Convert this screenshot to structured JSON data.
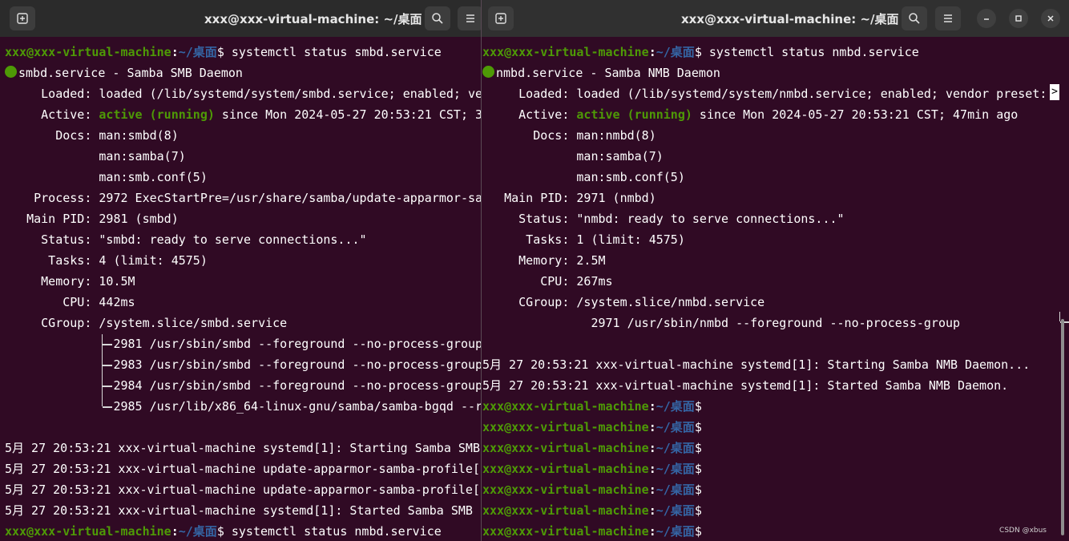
{
  "colors": {
    "terminal_bg": "#300a24",
    "titlebar_bg": "#2b2b2b",
    "prompt_user": "#4e9a06",
    "prompt_path": "#3465a4",
    "active": "#4e9a06"
  },
  "left_window": {
    "title": "xxx@xxx-virtual-machine: ~/桌面",
    "buttons": {
      "new_tab_icon": "new-tab-icon",
      "search_icon": "search-icon",
      "menu_icon": "hamburger-menu-icon"
    },
    "lines": [
      {
        "type": "prompt",
        "user": "xxx@xxx-virtual-machine",
        "colon": ":",
        "path": "~/桌面",
        "suffix": "$ systemctl status smbd.service"
      },
      {
        "type": "header",
        "text": "smbd.service - Samba SMB Daemon"
      },
      {
        "type": "plain",
        "text": "     Loaded: loaded (/lib/systemd/system/smbd.service; enabled; ve"
      },
      {
        "type": "active",
        "pre": "     Active: ",
        "mid": "active (running)",
        "post": " since Mon 2024-05-27 20:53:21 CST; 3"
      },
      {
        "type": "plain",
        "text": "       Docs: man:smbd(8)"
      },
      {
        "type": "plain",
        "text": "             man:samba(7)"
      },
      {
        "type": "plain",
        "text": "             man:smb.conf(5)"
      },
      {
        "type": "plain",
        "text": "    Process: 2972 ExecStartPre=/usr/share/samba/update-apparmor-sa"
      },
      {
        "type": "plain",
        "text": "   Main PID: 2981 (smbd)"
      },
      {
        "type": "plain",
        "text": "     Status: \"smbd: ready to serve connections...\""
      },
      {
        "type": "plain",
        "text": "      Tasks: 4 (limit: 4575)"
      },
      {
        "type": "plain",
        "text": "     Memory: 10.5M"
      },
      {
        "type": "plain",
        "text": "        CPU: 442ms"
      },
      {
        "type": "plain",
        "text": "     CGroup: /system.slice/smbd.service"
      },
      {
        "type": "plain",
        "text": "               2981 /usr/sbin/smbd --foreground --no-process-group"
      },
      {
        "type": "plain",
        "text": "               2983 /usr/sbin/smbd --foreground --no-process-group"
      },
      {
        "type": "plain",
        "text": "               2984 /usr/sbin/smbd --foreground --no-process-group"
      },
      {
        "type": "plain",
        "text": "               2985 /usr/lib/x86_64-linux-gnu/samba/samba-bgqd --r"
      },
      {
        "type": "plain",
        "text": ""
      },
      {
        "type": "plain",
        "text": "5月 27 20:53:21 xxx-virtual-machine systemd[1]: Starting Samba SMB"
      },
      {
        "type": "plain",
        "text": "5月 27 20:53:21 xxx-virtual-machine update-apparmor-samba-profile["
      },
      {
        "type": "plain",
        "text": "5月 27 20:53:21 xxx-virtual-machine update-apparmor-samba-profile["
      },
      {
        "type": "plain",
        "text": "5月 27 20:53:21 xxx-virtual-machine systemd[1]: Started Samba SMB "
      },
      {
        "type": "prompt",
        "user": "xxx@xxx-virtual-machine",
        "colon": ":",
        "path": "~/桌面",
        "suffix": "$ systemctl status nmbd.service"
      }
    ]
  },
  "right_window": {
    "title": "xxx@xxx-virtual-machine: ~/桌面",
    "buttons": {
      "new_tab_icon": "new-tab-icon",
      "search_icon": "search-icon",
      "menu_icon": "hamburger-menu-icon",
      "minimize_icon": "minimize-icon",
      "maximize_icon": "maximize-icon",
      "close_icon": "close-icon"
    },
    "lines": [
      {
        "type": "prompt",
        "user": "xxx@xxx-virtual-machine",
        "colon": ":",
        "path": "~/桌面",
        "suffix": "$ systemctl status nmbd.service"
      },
      {
        "type": "header",
        "text": "nmbd.service - Samba NMB Daemon"
      },
      {
        "type": "plain",
        "text": "     Loaded: loaded (/lib/systemd/system/nmbd.service; enabled; vendor preset: "
      },
      {
        "type": "active",
        "pre": "     Active: ",
        "mid": "active (running)",
        "post": " since Mon 2024-05-27 20:53:21 CST; 47min ago"
      },
      {
        "type": "plain",
        "text": "       Docs: man:nmbd(8)"
      },
      {
        "type": "plain",
        "text": "             man:samba(7)"
      },
      {
        "type": "plain",
        "text": "             man:smb.conf(5)"
      },
      {
        "type": "plain",
        "text": "   Main PID: 2971 (nmbd)"
      },
      {
        "type": "plain",
        "text": "     Status: \"nmbd: ready to serve connections...\""
      },
      {
        "type": "plain",
        "text": "      Tasks: 1 (limit: 4575)"
      },
      {
        "type": "plain",
        "text": "     Memory: 2.5M"
      },
      {
        "type": "plain",
        "text": "        CPU: 267ms"
      },
      {
        "type": "plain",
        "text": "     CGroup: /system.slice/nmbd.service"
      },
      {
        "type": "plain",
        "text": "               2971 /usr/sbin/nmbd --foreground --no-process-group"
      },
      {
        "type": "plain",
        "text": ""
      },
      {
        "type": "plain",
        "text": "5月 27 20:53:21 xxx-virtual-machine systemd[1]: Starting Samba NMB Daemon..."
      },
      {
        "type": "plain",
        "text": "5月 27 20:53:21 xxx-virtual-machine systemd[1]: Started Samba NMB Daemon."
      },
      {
        "type": "prompt",
        "user": "xxx@xxx-virtual-machine",
        "colon": ":",
        "path": "~/桌面",
        "suffix": "$"
      },
      {
        "type": "prompt",
        "user": "xxx@xxx-virtual-machine",
        "colon": ":",
        "path": "~/桌面",
        "suffix": "$"
      },
      {
        "type": "prompt",
        "user": "xxx@xxx-virtual-machine",
        "colon": ":",
        "path": "~/桌面",
        "suffix": "$"
      },
      {
        "type": "prompt",
        "user": "xxx@xxx-virtual-machine",
        "colon": ":",
        "path": "~/桌面",
        "suffix": "$"
      },
      {
        "type": "prompt",
        "user": "xxx@xxx-virtual-machine",
        "colon": ":",
        "path": "~/桌面",
        "suffix": "$"
      },
      {
        "type": "prompt",
        "user": "xxx@xxx-virtual-machine",
        "colon": ":",
        "path": "~/桌面",
        "suffix": "$"
      },
      {
        "type": "prompt",
        "user": "xxx@xxx-virtual-machine",
        "colon": ":",
        "path": "~/桌面",
        "suffix": "$"
      }
    ],
    "overflow_marker": ">"
  },
  "watermark": "CSDN @xbus"
}
